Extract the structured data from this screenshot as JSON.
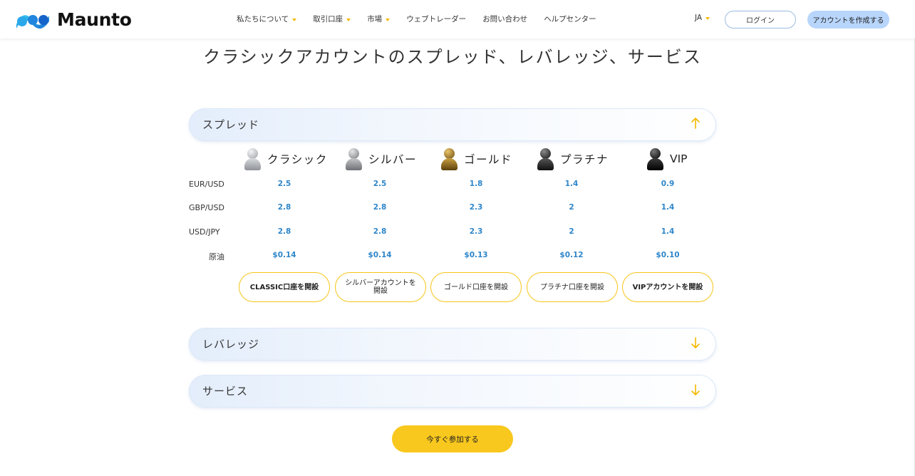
{
  "header": {
    "brand": "Maunto",
    "nav": [
      {
        "label": "私たちについて",
        "has_dropdown": true
      },
      {
        "label": "取引口座",
        "has_dropdown": true
      },
      {
        "label": "市場",
        "has_dropdown": true
      },
      {
        "label": "ウェブトレーダー",
        "has_dropdown": false
      },
      {
        "label": "お問い合わせ",
        "has_dropdown": false
      },
      {
        "label": "ヘルプセンター",
        "has_dropdown": false
      }
    ],
    "language": "JA",
    "login_label": "ログイン",
    "create_account_label": "アカウントを作成する"
  },
  "page_title": "クラシックアカウントのスプレッド、レバレッジ、サービス",
  "sections": {
    "spread": {
      "title": "スプレッド",
      "expanded": true
    },
    "leverage": {
      "title": "レバレッジ",
      "expanded": false
    },
    "services": {
      "title": "サービス",
      "expanded": false
    }
  },
  "tiers": [
    {
      "name": "クラシック",
      "color": "#b9bcc0",
      "button": "CLASSIC口座を開設"
    },
    {
      "name": "シルバー",
      "color": "#9a9ea3",
      "button": "シルバーアカウントを開設"
    },
    {
      "name": "ゴールド",
      "color": "#8a6a1c",
      "button": "ゴールド口座を開設"
    },
    {
      "name": "プラチナ",
      "color": "#2b2b2b",
      "button": "プラチナ口座を開設"
    },
    {
      "name": "VIP",
      "color": "#111111",
      "button": "VIPアカウントを開設"
    }
  ],
  "spread_table": {
    "rows": [
      {
        "label": "EUR/USD",
        "values": [
          "2.5",
          "2.5",
          "1.8",
          "1.4",
          "0.9"
        ]
      },
      {
        "label": "GBP/USD",
        "values": [
          "2.8",
          "2.8",
          "2.3",
          "2",
          "1.4"
        ]
      },
      {
        "label": "USD/JPY",
        "values": [
          "2.8",
          "2.8",
          "2.3",
          "2",
          "1.4"
        ]
      },
      {
        "label": "原油",
        "values": [
          "$0.14",
          "$0.14",
          "$0.13",
          "$0.12",
          "$0.10"
        ]
      }
    ]
  },
  "cta": {
    "join_label": "今すぐ参加する"
  },
  "colors": {
    "accent_yellow": "#f9c81e",
    "value_blue": "#2f86c9",
    "login_border": "#9bbce0",
    "create_bg": "#b8d5fb"
  }
}
